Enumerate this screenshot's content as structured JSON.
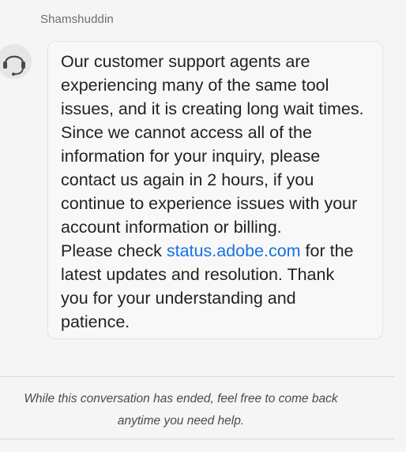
{
  "message": {
    "agent_name": "Shamshuddin",
    "avatar_icon": "headset-agent-icon",
    "lines": [
      "Our customer support agents are",
      "experiencing many of the same tool",
      "issues, and it is creating long wait times.",
      "Since we cannot access all of the",
      "information for your inquiry, please",
      "contact us again in 2 hours, if you",
      "continue to experience issues with your",
      "account information or billing."
    ],
    "check_prefix": "Please check ",
    "link_text": "status.adobe.com",
    "check_suffix": " for the",
    "tail_lines": [
      "latest updates and resolution.  Thank",
      "you for your understanding and",
      "patience."
    ]
  },
  "footer": {
    "ended_line1": "While this conversation has ended, feel free to come back",
    "ended_line2": "anytime you need help."
  },
  "colors": {
    "link": "#1473e6",
    "background": "#f5f5f5",
    "bubble": "#f8f8f8"
  }
}
